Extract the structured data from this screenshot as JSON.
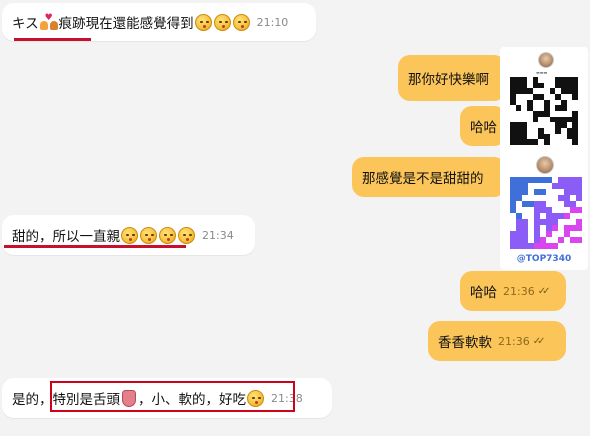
{
  "messages": [
    {
      "id": "m1",
      "side": "in",
      "prefix": "キス",
      "text": "痕跡現在還能感覺得到",
      "time": "21:10"
    },
    {
      "id": "m2",
      "side": "out",
      "text": "那你好快樂啊",
      "time": ""
    },
    {
      "id": "m3",
      "side": "out",
      "text": "哈哈",
      "time": ""
    },
    {
      "id": "m4",
      "side": "out",
      "text": "那感覺是不是甜甜的",
      "time": ""
    },
    {
      "id": "m5",
      "side": "in",
      "text": "甜的，所以一直親",
      "time": "21:34"
    },
    {
      "id": "m6",
      "side": "out",
      "text": "哈哈",
      "time": "21:36"
    },
    {
      "id": "m7",
      "side": "out",
      "text": "香香軟軟",
      "time": "21:36"
    },
    {
      "id": "m8",
      "side": "in",
      "text_before": "是的，",
      "text_boxed": "特別是舌頭",
      "text_after": "，小、軟的，好吃",
      "time": "21:38"
    }
  ],
  "overlay": {
    "handle": "@TOP7340",
    "qr_top_color": "#111111",
    "qr_bottom_colors": [
      "#3f6fd8",
      "#8b5cf6",
      "#d946ef"
    ]
  },
  "colors": {
    "background": "#f3f3f3",
    "incoming_bubble": "#ffffff",
    "outgoing_bubble": "#fbc559",
    "annotation_red": "#c8102e"
  }
}
